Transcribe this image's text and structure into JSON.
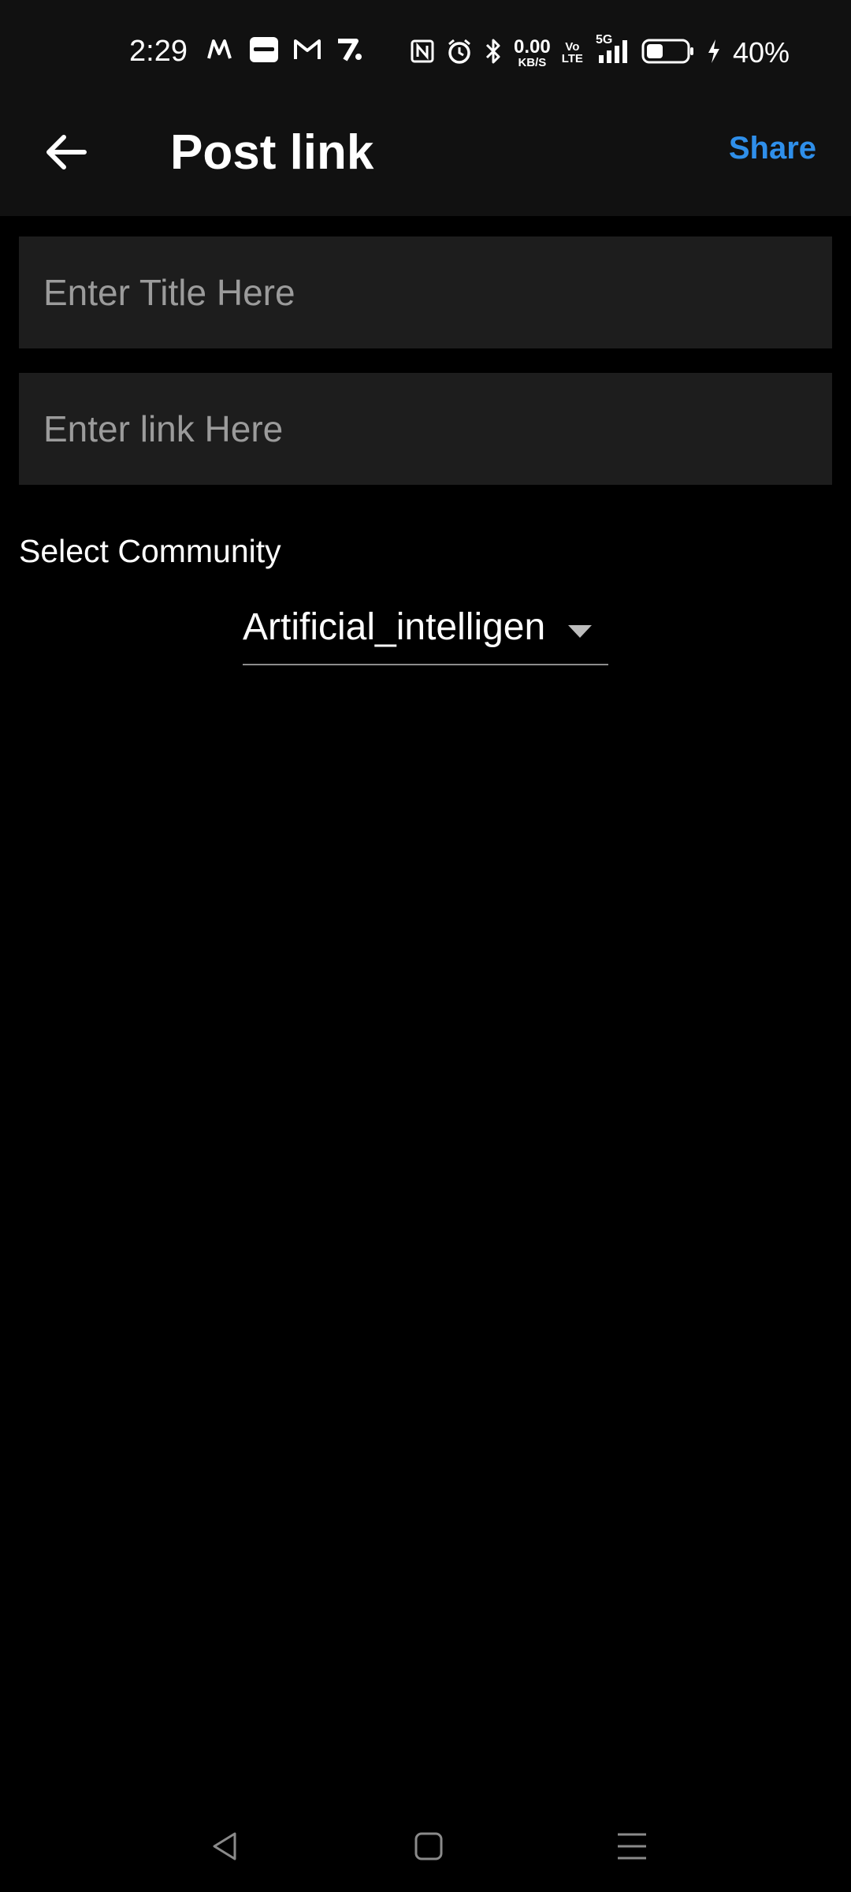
{
  "status_bar": {
    "time": "2:29",
    "net_speed_value": "0.00",
    "net_speed_unit": "KB/S",
    "volte_top": "Vo",
    "volte_bottom": "LTE",
    "network": "5G",
    "battery_percent": "40%",
    "left_icons": [
      "myntra-icon",
      "zomato-icon",
      "gmail-icon",
      "zepto-icon"
    ],
    "right_icons": [
      "nfc-icon",
      "alarm-icon",
      "bluetooth-icon",
      "signal-icon",
      "battery-icon",
      "charging-icon"
    ]
  },
  "app_bar": {
    "title": "Post link",
    "share_label": "Share",
    "back_icon": "arrow-left-icon"
  },
  "form": {
    "title_placeholder": "Enter Title Here",
    "title_value": "",
    "link_placeholder": "Enter link Here",
    "link_value": "",
    "community_label": "Select Community",
    "community_selected": "Artificial_intelligen"
  },
  "nav_bar": {
    "icons": [
      "nav-back-icon",
      "nav-home-icon",
      "nav-recents-icon"
    ]
  },
  "colors": {
    "background": "#000000",
    "bar": "#111111",
    "field": "#1d1d1d",
    "accent": "#2f8fea",
    "placeholder": "#9b9b9b"
  }
}
